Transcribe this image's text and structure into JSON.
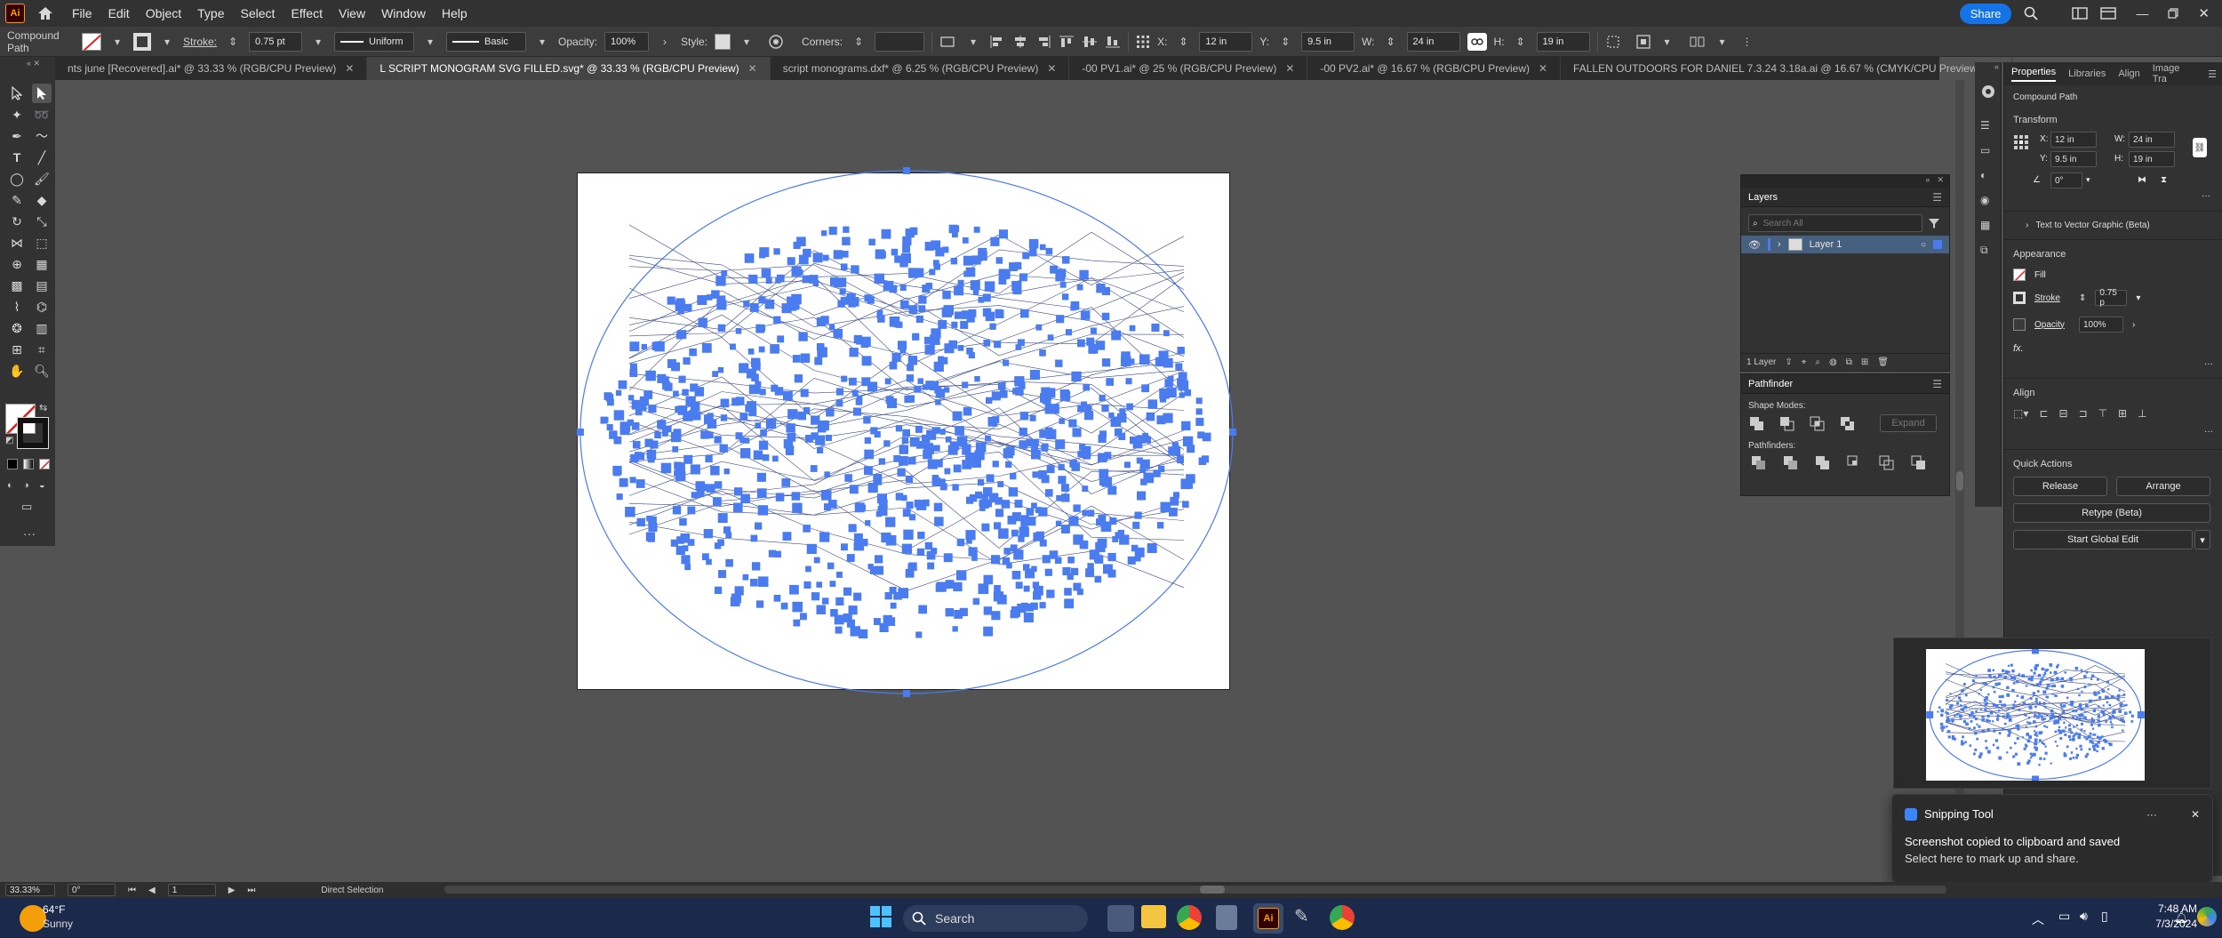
{
  "app": {
    "logo": "Ai",
    "menus": [
      "File",
      "Edit",
      "Object",
      "Type",
      "Select",
      "Effect",
      "View",
      "Window",
      "Help"
    ],
    "share_label": "Share"
  },
  "control_bar": {
    "selection_type": "Compound Path",
    "stroke_label": "Stroke:",
    "stroke_value": "0.75 pt",
    "profile": "Uniform",
    "brush": "Basic",
    "opacity_label": "Opacity:",
    "opacity_value": "100%",
    "style_label": "Style:",
    "corners_label": "Corners:",
    "x_label": "X:",
    "x_value": "12 in",
    "y_label": "Y:",
    "y_value": "9.5 in",
    "w_label": "W:",
    "w_value": "24 in",
    "h_label": "H:",
    "h_value": "19 in"
  },
  "tabs": [
    {
      "label": "nts june [Recovered].ai* @ 33.33 % (RGB/CPU Preview)",
      "active": false
    },
    {
      "label": "L SCRIPT MONOGRAM SVG FILLED.svg* @ 33.33 % (RGB/CPU Preview)",
      "active": true
    },
    {
      "label": "script monograms.dxf* @ 6.25 % (RGB/CPU Preview)",
      "active": false
    },
    {
      "label": "-00 PV1.ai* @ 25 % (RGB/CPU Preview)",
      "active": false
    },
    {
      "label": "-00 PV2.ai* @ 16.67 % (RGB/CPU Preview)",
      "active": false
    },
    {
      "label": "FALLEN OUTDOORS FOR DANIEL 7.3.24 3.18a.ai @ 16.67 % (CMYK/CPU Preview)",
      "active": false
    }
  ],
  "layers_panel": {
    "title": "Layers",
    "search_placeholder": "Search All",
    "layer_name": "Layer 1",
    "count": "1 Layer"
  },
  "pathfinder_panel": {
    "title": "Pathfinder",
    "shape_modes": "Shape Modes:",
    "pathfinders": "Pathfinders:",
    "expand": "Expand"
  },
  "properties_panel": {
    "tabs": [
      "Properties",
      "Libraries",
      "Align",
      "Image Tra"
    ],
    "object_type": "Compound Path",
    "transform_title": "Transform",
    "x": "12 in",
    "y": "9.5 in",
    "w": "24 in",
    "h": "19 in",
    "angle": "0°",
    "text_to_vector": "Text to Vector Graphic (Beta)",
    "appearance_title": "Appearance",
    "fill_label": "Fill",
    "stroke_label": "Stroke",
    "stroke_value": "0.75 p",
    "opacity_label": "Opacity",
    "opacity_value": "100%",
    "fx": "fx.",
    "align_title": "Align",
    "quick_actions_title": "Quick Actions",
    "release": "Release",
    "arrange": "Arrange",
    "retype": "Retype (Beta)",
    "global_edit": "Start Global Edit"
  },
  "status_bar": {
    "zoom": "33.33%",
    "angle": "0°",
    "artboard": "1",
    "tool": "Direct Selection"
  },
  "toast": {
    "app": "Snipping Tool",
    "line1": "Screenshot copied to clipboard and saved",
    "line2": "Select here to mark up and share."
  },
  "taskbar": {
    "weather_temp": "64°F",
    "weather_text": "Sunny",
    "search": "Search",
    "time": "7:48 AM",
    "date": "7/3/2024"
  },
  "colors": {
    "accent": "#1473e6",
    "path_blue": "#4a7cf0",
    "ui_dark": "#323232"
  }
}
